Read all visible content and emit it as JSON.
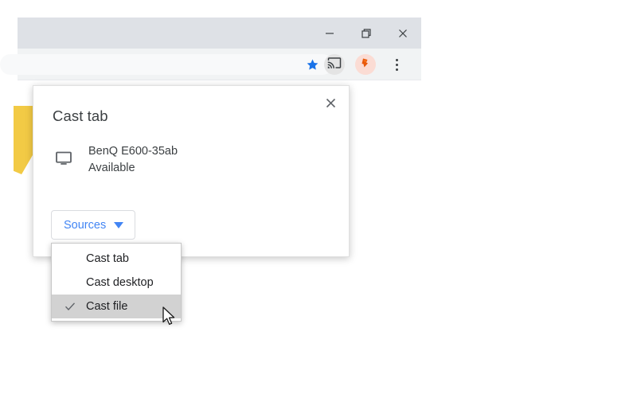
{
  "window": {
    "controls": [
      {
        "name": "minimize",
        "icon": "minimize-icon",
        "tooltip": "Minimize"
      },
      {
        "name": "restore",
        "icon": "restore-icon",
        "tooltip": "Restore"
      },
      {
        "name": "close",
        "icon": "close-icon",
        "tooltip": "Close"
      }
    ]
  },
  "toolbar": {
    "omnibox_value": "",
    "omnibox_placeholder": "",
    "bookmark_icon": "star-icon",
    "cast_icon": "cast-icon",
    "extension_icon": "extension-icon",
    "menu_icon": "three-dot-menu-icon"
  },
  "cast_popup": {
    "title": "Cast tab",
    "close_label": "✕",
    "device": {
      "icon": "monitor-icon",
      "name": "BenQ E600-35ab",
      "status": "Available"
    },
    "sources_button": {
      "label": "Sources",
      "caret": "chevron-down-icon"
    }
  },
  "sources_menu": {
    "items": [
      {
        "label": "Cast tab",
        "checked": false
      },
      {
        "label": "Cast desktop",
        "checked": false
      },
      {
        "label": "Cast file",
        "checked": true
      }
    ],
    "check_glyph": "✓"
  },
  "colors": {
    "titlebar": "#dee1e6",
    "toolbar": "#f1f3f4",
    "omnibox": "#f8f9fa",
    "accent_blue": "#4285f4",
    "star_blue": "#1a73e8",
    "yellow_shape": "#f2ca45",
    "menu_highlight": "#d2d2d2",
    "text": "#3c4043"
  }
}
